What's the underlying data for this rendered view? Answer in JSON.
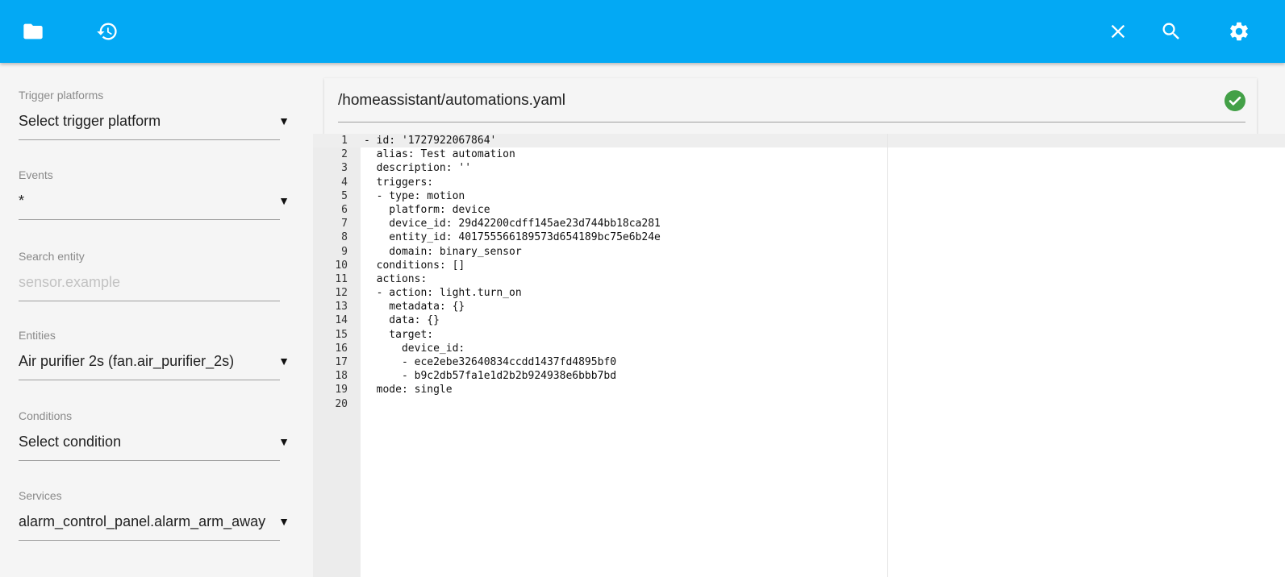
{
  "toolbar": {
    "left_icons": [
      "folder-icon",
      "history-icon"
    ],
    "right_icons": [
      "close-icon",
      "search-icon",
      "gear-icon"
    ],
    "color": "#03a9f4"
  },
  "sidebar": {
    "trigger_platforms": {
      "label": "Trigger platforms",
      "value": "Select trigger platform"
    },
    "events": {
      "label": "Events",
      "value": "*"
    },
    "search_entity": {
      "label": "Search entity",
      "placeholder": "sensor.example"
    },
    "entities": {
      "label": "Entities",
      "value": "Air purifier 2s (fan.air_purifier_2s)"
    },
    "conditions": {
      "label": "Conditions",
      "value": "Select condition"
    },
    "services": {
      "label": "Services",
      "value": "alarm_control_panel.alarm_arm_away"
    }
  },
  "file": {
    "path": "/homeassistant/automations.yaml",
    "status_icon": "check-circle-icon",
    "status_color": "#43a047"
  },
  "editor": {
    "lines": [
      "- id: '1727922067864'",
      "  alias: Test automation",
      "  description: ''",
      "  triggers:",
      "  - type: motion",
      "    platform: device",
      "    device_id: 29d42200cdff145ae23d744bb18ca281",
      "    entity_id: 401755566189573d654189bc75e6b24e",
      "    domain: binary_sensor",
      "  conditions: []",
      "  actions:",
      "  - action: light.turn_on",
      "    metadata: {}",
      "    data: {}",
      "    target:",
      "      device_id:",
      "      - ece2ebe32640834ccdd1437fd4895bf0",
      "      - b9c2db57fa1e1d2b2b924938e6bbb7bd",
      "  mode: single",
      ""
    ]
  }
}
